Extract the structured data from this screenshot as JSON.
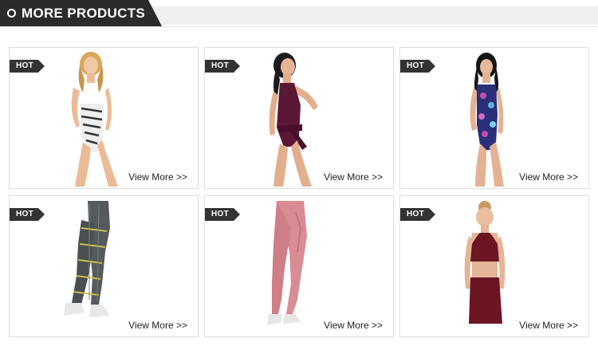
{
  "section": {
    "title": "MORE PRODUCTS"
  },
  "colors": {
    "header_dark": "#2b2b2b",
    "header_band": "#efefef",
    "badge": "#333333"
  },
  "products": [
    {
      "badge": "HOT",
      "link": "View More >>",
      "image": "zebra-print swimsuit"
    },
    {
      "badge": "HOT",
      "link": "View More >>",
      "image": "burgundy halter swimsuit"
    },
    {
      "badge": "HOT",
      "link": "View More >>",
      "image": "floral swimsuit"
    },
    {
      "badge": "HOT",
      "link": "View More >>",
      "image": "striped leggings"
    },
    {
      "badge": "HOT",
      "link": "View More >>",
      "image": "pink leggings"
    },
    {
      "badge": "HOT",
      "link": "View More >>",
      "image": "burgundy sports bra set"
    }
  ]
}
